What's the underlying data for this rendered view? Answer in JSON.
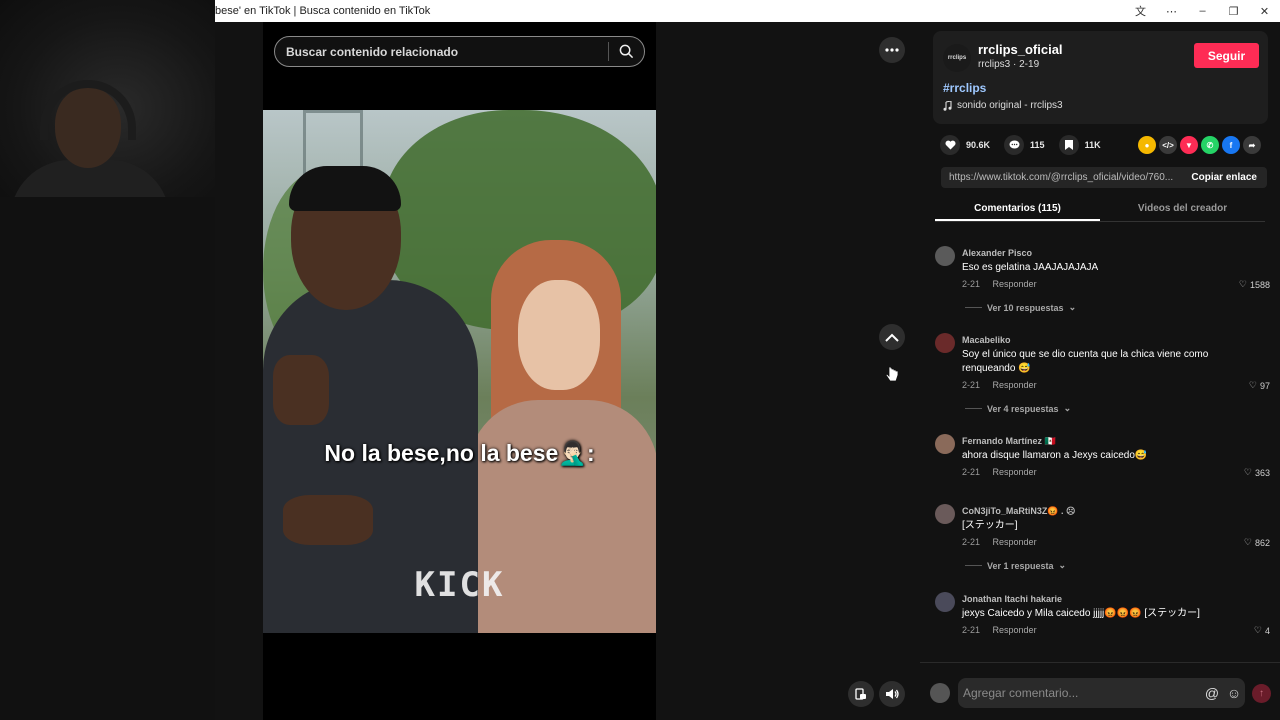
{
  "window": {
    "title": "bese' en TikTok | Busca contenido en TikTok",
    "controls": [
      "文",
      "⋯",
      "–",
      "❐",
      "✕"
    ]
  },
  "search": {
    "placeholder": "Buscar contenido relacionado"
  },
  "video": {
    "caption": "No la bese,no la bese🤦🏻‍♂️:",
    "watermark": "KICK"
  },
  "creator": {
    "avatar_text": "rrclips",
    "name": "rrclips_oficial",
    "meta": "rrclips3 · 2-19",
    "follow_label": "Seguir",
    "hashtag": "#rrclips",
    "sound": "sonido original - rrclips3"
  },
  "stats": {
    "likes": "90.6K",
    "comments": "115",
    "saves": "11K"
  },
  "share_colors": [
    "#f5b800",
    "#3a3a3a",
    "#fe2c55",
    "#25d366",
    "#1877f2",
    "#3a3a3a"
  ],
  "link": {
    "url": "https://www.tiktok.com/@rrclips_oficial/video/760...",
    "copy_label": "Copiar enlace"
  },
  "tabs": [
    {
      "label": "Comentarios (115)"
    },
    {
      "label": "Videos del creador"
    }
  ],
  "reply_label": "Responder",
  "comments": [
    {
      "user": "Alexander Pisco",
      "text": "Eso es gelatina JAAJAJAJAJA",
      "date": "2-21",
      "likes": "1588",
      "replies": "Ver 10 respuestas"
    },
    {
      "user": "Macabeliko",
      "text": "Soy el único que se dio cuenta que la chica viene como renqueando 😅",
      "date": "2-21",
      "likes": "97",
      "replies": "Ver 4 respuestas"
    },
    {
      "user": "Fernando Martínez 🇲🇽",
      "text": "ahora disque llamaron a Jexys caicedo😅",
      "date": "2-21",
      "likes": "363",
      "replies": ""
    },
    {
      "user": "CoN3jiTo_MaRtiN3Z😡 . ☹",
      "text": "[ステッカー]",
      "date": "2-21",
      "likes": "862",
      "replies": "Ver 1 respuesta"
    },
    {
      "user": "Jonathan Itachi hakarie",
      "text": "jexys Caicedo y Mila caicedo jjjjj😡😡😡 [ステッカー]",
      "date": "2-21",
      "likes": "4",
      "replies": ""
    }
  ],
  "comment_input": {
    "placeholder": "Agregar comentario..."
  }
}
